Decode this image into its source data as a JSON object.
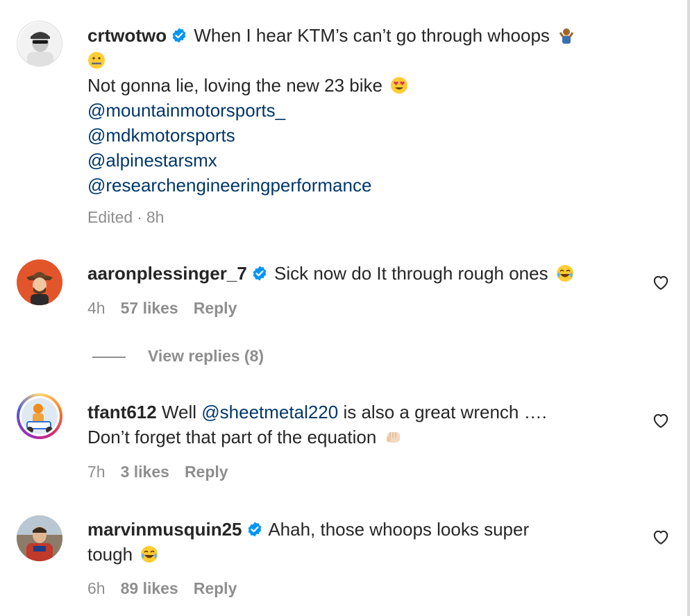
{
  "comments": [
    {
      "username": "crtwotwo",
      "verified": true,
      "text_line1": "When I hear KTM’s can’t go through whoops",
      "text_line2": "Not gonna lie, loving the new 23 bike",
      "mentions": [
        "@mountainmotorsports_",
        "@mdkmotorsports",
        "@alpinestarsmx",
        "@researchengineeringperformance"
      ],
      "edited": "Edited",
      "separator": "·",
      "time": "8h",
      "emojis": [
        "man-shrugging-emoji",
        "zipper-mouth-emoji",
        "heart-eyes-emoji"
      ]
    },
    {
      "username": "aaronplessinger_7",
      "verified": true,
      "text": "Sick now do It through rough ones",
      "time": "4h",
      "likes": "57 likes",
      "reply": "Reply",
      "emojis": [
        "tears-of-joy-emoji"
      ]
    },
    {
      "username": "tfant612",
      "verified": false,
      "text_before": "Well",
      "mention": "@sheetmetal220",
      "text_after": "is also a great wrench ….",
      "text_line2": "Don’t forget that part of the equation",
      "time": "7h",
      "likes": "3 likes",
      "reply": "Reply",
      "emojis": [
        "fist-bump-emoji"
      ]
    },
    {
      "username": "marvinmusquin25",
      "verified": true,
      "text_line1": "Ahah, those whoops looks super",
      "text_line2": "tough",
      "time": "6h",
      "likes": "89 likes",
      "reply": "Reply",
      "emojis": [
        "tears-of-joy-emoji"
      ]
    }
  ],
  "view_replies": "View replies (8)",
  "colors": {
    "text": "#262626",
    "secondary": "#8e8e8e",
    "mention": "#00376b",
    "verified": "#0095f6"
  },
  "icons": [
    "verified-badge-icon",
    "heart-icon",
    "avatar"
  ]
}
